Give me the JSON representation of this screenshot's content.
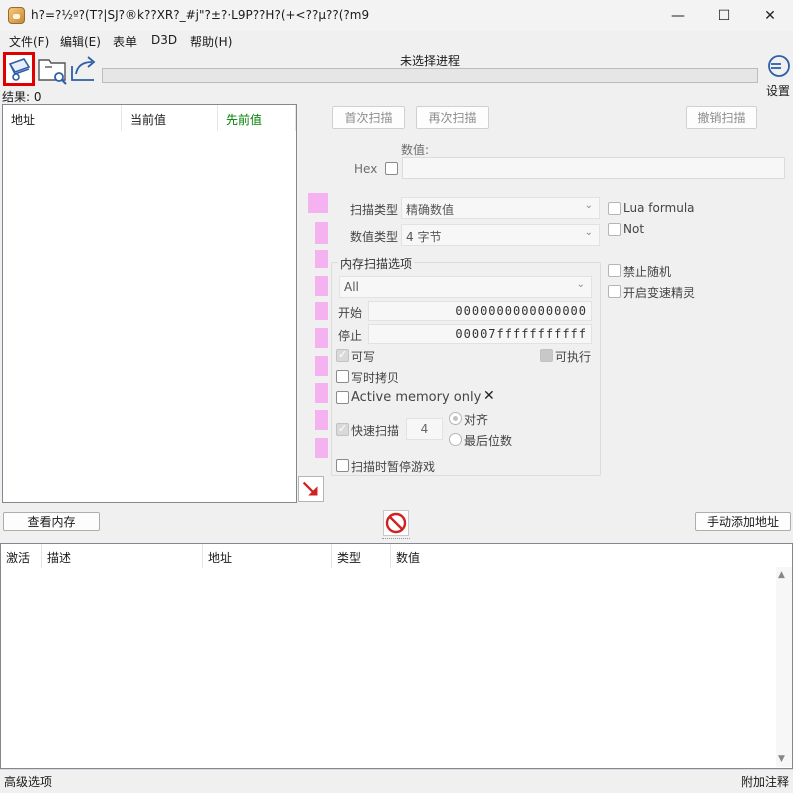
{
  "window": {
    "title": "h?=?½º?(T?|SJ?®k??XR?_#j\"?±?·L9P??H?(+<??µ??(?m9",
    "controls": {
      "minimize": "—",
      "maximize": "☐",
      "close": "✕"
    }
  },
  "menu": [
    "文件(F)",
    "编辑(E)",
    "表单",
    "D3D",
    "帮助(H)"
  ],
  "toolbar": {
    "process_label": "未选择进程",
    "settings_label": "设置",
    "progress": 0
  },
  "results_label": "结果: 0",
  "result_list": {
    "columns": [
      "地址",
      "当前值",
      "先前值"
    ],
    "prev_color": "#008000"
  },
  "scan": {
    "first_scan": "首次扫描",
    "next_scan": "再次扫描",
    "undo_scan": "撤销扫描",
    "value_label": "数值:",
    "hex_label": "Hex",
    "scan_type_label": "扫描类型",
    "scan_type_value": "精确数值",
    "value_type_label": "数值类型",
    "value_type_value": "4 字节"
  },
  "options": {
    "lua_formula": "Lua formula",
    "not": "Not",
    "disable_random": "禁止随机",
    "speedhack": "开启变速精灵"
  },
  "memory": {
    "group_title": "内存扫描选项",
    "region": "All",
    "start_label": "开始",
    "start_value": "0000000000000000",
    "stop_label": "停止",
    "stop_value": "00007fffffffffff",
    "writable": "可写",
    "executable": "可执行",
    "copy_on_write": "写时拷贝",
    "active_memory": "Active memory only",
    "fast_scan": "快速扫描",
    "fast_scan_value": "4",
    "align": "对齐",
    "last_digits": "最后位数",
    "pause_game": "扫描时暂停游戏"
  },
  "buttons": {
    "view_memory": "查看内存",
    "add_address": "手动添加地址"
  },
  "address_table": {
    "columns": [
      "激活",
      "描述",
      "地址",
      "类型",
      "数值"
    ]
  },
  "status": {
    "advanced": "高级选项",
    "comments": "附加注释"
  },
  "colors": {
    "accent_red": "#e00000",
    "pink_decor": "#f59ef0"
  }
}
